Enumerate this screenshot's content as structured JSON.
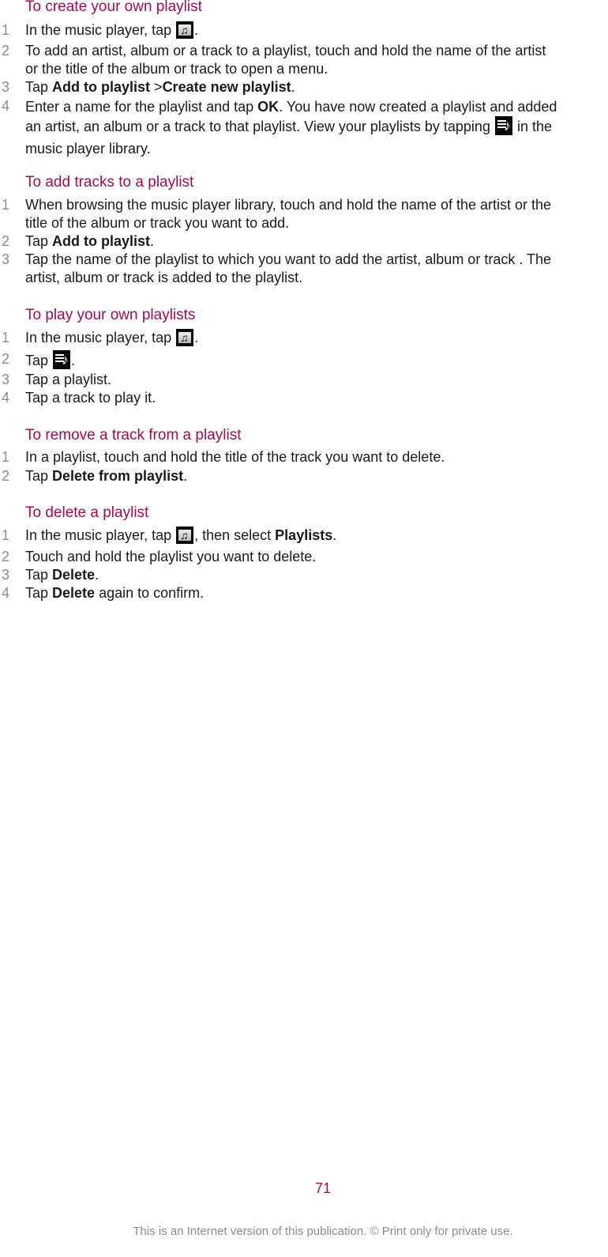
{
  "sections": [
    {
      "heading": "To create your own playlist",
      "steps": [
        {
          "num": "1",
          "parts": [
            "In the music player, tap ",
            "{music-folder-icon}",
            "."
          ]
        },
        {
          "num": "2",
          "lines": [
            "To add an artist, album or a track to a playlist, touch and hold the name of the artist",
            "or the title of the album or track to open a menu."
          ]
        },
        {
          "num": "3",
          "pre": "Tap ",
          "bold1": "Add to playlist",
          "mid": " >",
          "bold2": "Create new playlist",
          "post": "."
        },
        {
          "num": "4",
          "line1_pre": "Enter a name for the playlist and tap ",
          "line1_bold": "OK",
          "line1_post": ". You have now created a playlist and added",
          "line2_pre": "an artist, an album or a track to that playlist. View your playlists by tapping ",
          "line2_post": " in the",
          "line3": "music player library."
        }
      ]
    },
    {
      "heading": "To add tracks to a playlist",
      "steps": [
        {
          "num": "1",
          "lines": [
            "When browsing the music player library, touch and hold the name of the artist or the",
            "title of the album or track you want to add."
          ]
        },
        {
          "num": "2",
          "pre": "Tap ",
          "bold": "Add to playlist",
          "post": "."
        },
        {
          "num": "3",
          "lines": [
            "Tap the name of the playlist to which you want to add the artist, album or track . The",
            "artist, album or track is added to the playlist."
          ]
        }
      ]
    },
    {
      "heading": "To play your own playlists",
      "steps": [
        {
          "num": "1",
          "pre": "In the music player, tap ",
          "post": "."
        },
        {
          "num": "2",
          "pre": "Tap ",
          "post": "."
        },
        {
          "num": "3",
          "text": "Tap a playlist."
        },
        {
          "num": "4",
          "text": "Tap a track to play it."
        }
      ]
    },
    {
      "heading": "To remove a track from a playlist",
      "steps": [
        {
          "num": "1",
          "text": "In a playlist, touch and hold the title of the track you want to delete."
        },
        {
          "num": "2",
          "pre": "Tap ",
          "bold": "Delete from playlist",
          "post": "."
        }
      ]
    },
    {
      "heading": "To delete a playlist",
      "steps": [
        {
          "num": "1",
          "pre": "In the music player, tap ",
          "mid": ", then select ",
          "bold": "Playlists",
          "post": "."
        },
        {
          "num": "2",
          "text": "Touch and hold the playlist you want to delete."
        },
        {
          "num": "3",
          "pre": "Tap ",
          "bold": "Delete",
          "post": "."
        },
        {
          "num": "4",
          "pre": "Tap ",
          "bold": "Delete",
          "post": " again to confirm."
        }
      ]
    }
  ],
  "page_number": "71",
  "footer": "This is an Internet version of this publication. © Print only for private use.",
  "colors": {
    "heading": "#9b0d54",
    "step_number": "#8c8c8c",
    "body": "#1a1a1a",
    "footer": "#8a8a8a"
  },
  "icons": {
    "music_player": "music-folder-icon",
    "playlists": "playlist-icon"
  }
}
